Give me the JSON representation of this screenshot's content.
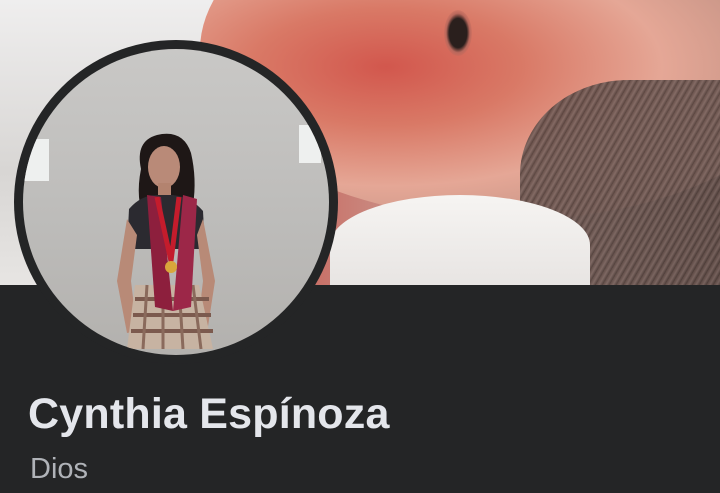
{
  "profile": {
    "name": "Cynthia Espínoza",
    "bio": "Dios"
  },
  "colors": {
    "background": "#242526",
    "name_text": "#e4e6eb",
    "bio_text": "#b0b3b8"
  },
  "images": {
    "cover_photo": "newborn-baby-close-up",
    "profile_photo": "graduate-with-sash-and-medal"
  }
}
